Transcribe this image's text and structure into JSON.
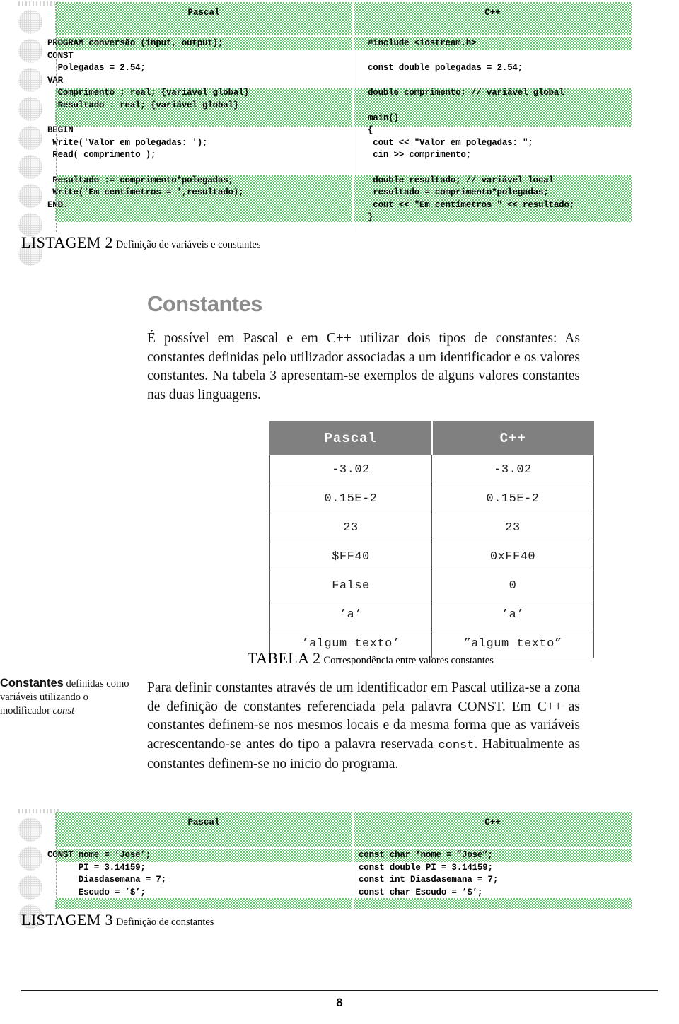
{
  "listing2": {
    "pascal_header": "Pascal",
    "cpp_header": "C++",
    "pascal_code": "PROGRAM conversão (input, output);\nCONST\n  Polegadas = 2.54;\nVAR\n  Comprimento ; real; {variável global}\n  Resultado : real; {variável global}\n\nBEGIN\n Write('Valor em polegadas: ');\n Read( comprimento );\n\n Resultado := comprimento*polegadas;\n Write('Em centímetros = ',resultado);\nEND.",
    "cpp_code": "#include <iostream.h>\n\nconst double polegadas = 2.54;\n\ndouble comprimento; // variável global\n\nmain()\n{\n cout << \"Valor em polegadas: \";\n cin >> comprimento;\n\n double resultado; // variável local\n resultado = comprimento*polegadas;\n cout << \"Em centímetros \" << resultado;\n}",
    "caption_lead": "LISTAGEM 2",
    "caption_text": "Definição de variáveis e constantes"
  },
  "section": {
    "heading": "Constantes",
    "paragraph": "É possível em Pascal e em C++ utilizar dois tipos de constantes: As constantes definidas pelo utilizador associadas a um identificador e os valores constantes. Na tabela 3 apresentam-se exemplos de alguns valores constantes nas duas linguagens."
  },
  "table": {
    "headers": [
      "Pascal",
      "C++"
    ],
    "rows": [
      [
        "-3.02",
        "-3.02"
      ],
      [
        "0.15E-2",
        "0.15E-2"
      ],
      [
        "23",
        "23"
      ],
      [
        "$FF40",
        "0xFF40"
      ],
      [
        "False",
        "0"
      ],
      [
        "’a’",
        "’a’"
      ],
      [
        "’algum texto’",
        "”algum texto”"
      ]
    ],
    "caption_lead": "TABELA 2",
    "caption_text": "Correspondência entre valores constantes"
  },
  "margin_note": {
    "bold": "Constantes",
    "rest": " definidas como variáveis utilizando o modificador ",
    "italic": "const"
  },
  "paragraph2": {
    "part1": "Para definir constantes através de um identificador em Pascal utiliza-se a zona de definição de constantes referenciada pela palavra CONST. Em C++ as constantes definem-se nos mesmos locais e da mesma forma que as variáveis acrescentando-se antes do tipo a palavra reservada ",
    "mono": "const",
    "part2": ". Habitualmente as constantes definem-se no inicio do programa."
  },
  "listing3": {
    "pascal_header": "Pascal",
    "cpp_header": "C++",
    "pascal_code": "CONST nome = ’José’;\n      PI = 3.14159;\n      Diasdasemana = 7;\n      Escudo = ’$’;",
    "cpp_code": "const char *nome = ”José”;\nconst double PI = 3.14159;\nconst int Diasdasemana = 7;\nconst char Escudo = ’$’;",
    "caption_lead": "LISTAGEM 3",
    "caption_text": "Definição de constantes"
  },
  "footer": {
    "page_number": "8"
  },
  "colors": {
    "code_green": "#3ab54a",
    "heading_gray": "#8c8c8c",
    "table_header_gray": "#808080"
  }
}
